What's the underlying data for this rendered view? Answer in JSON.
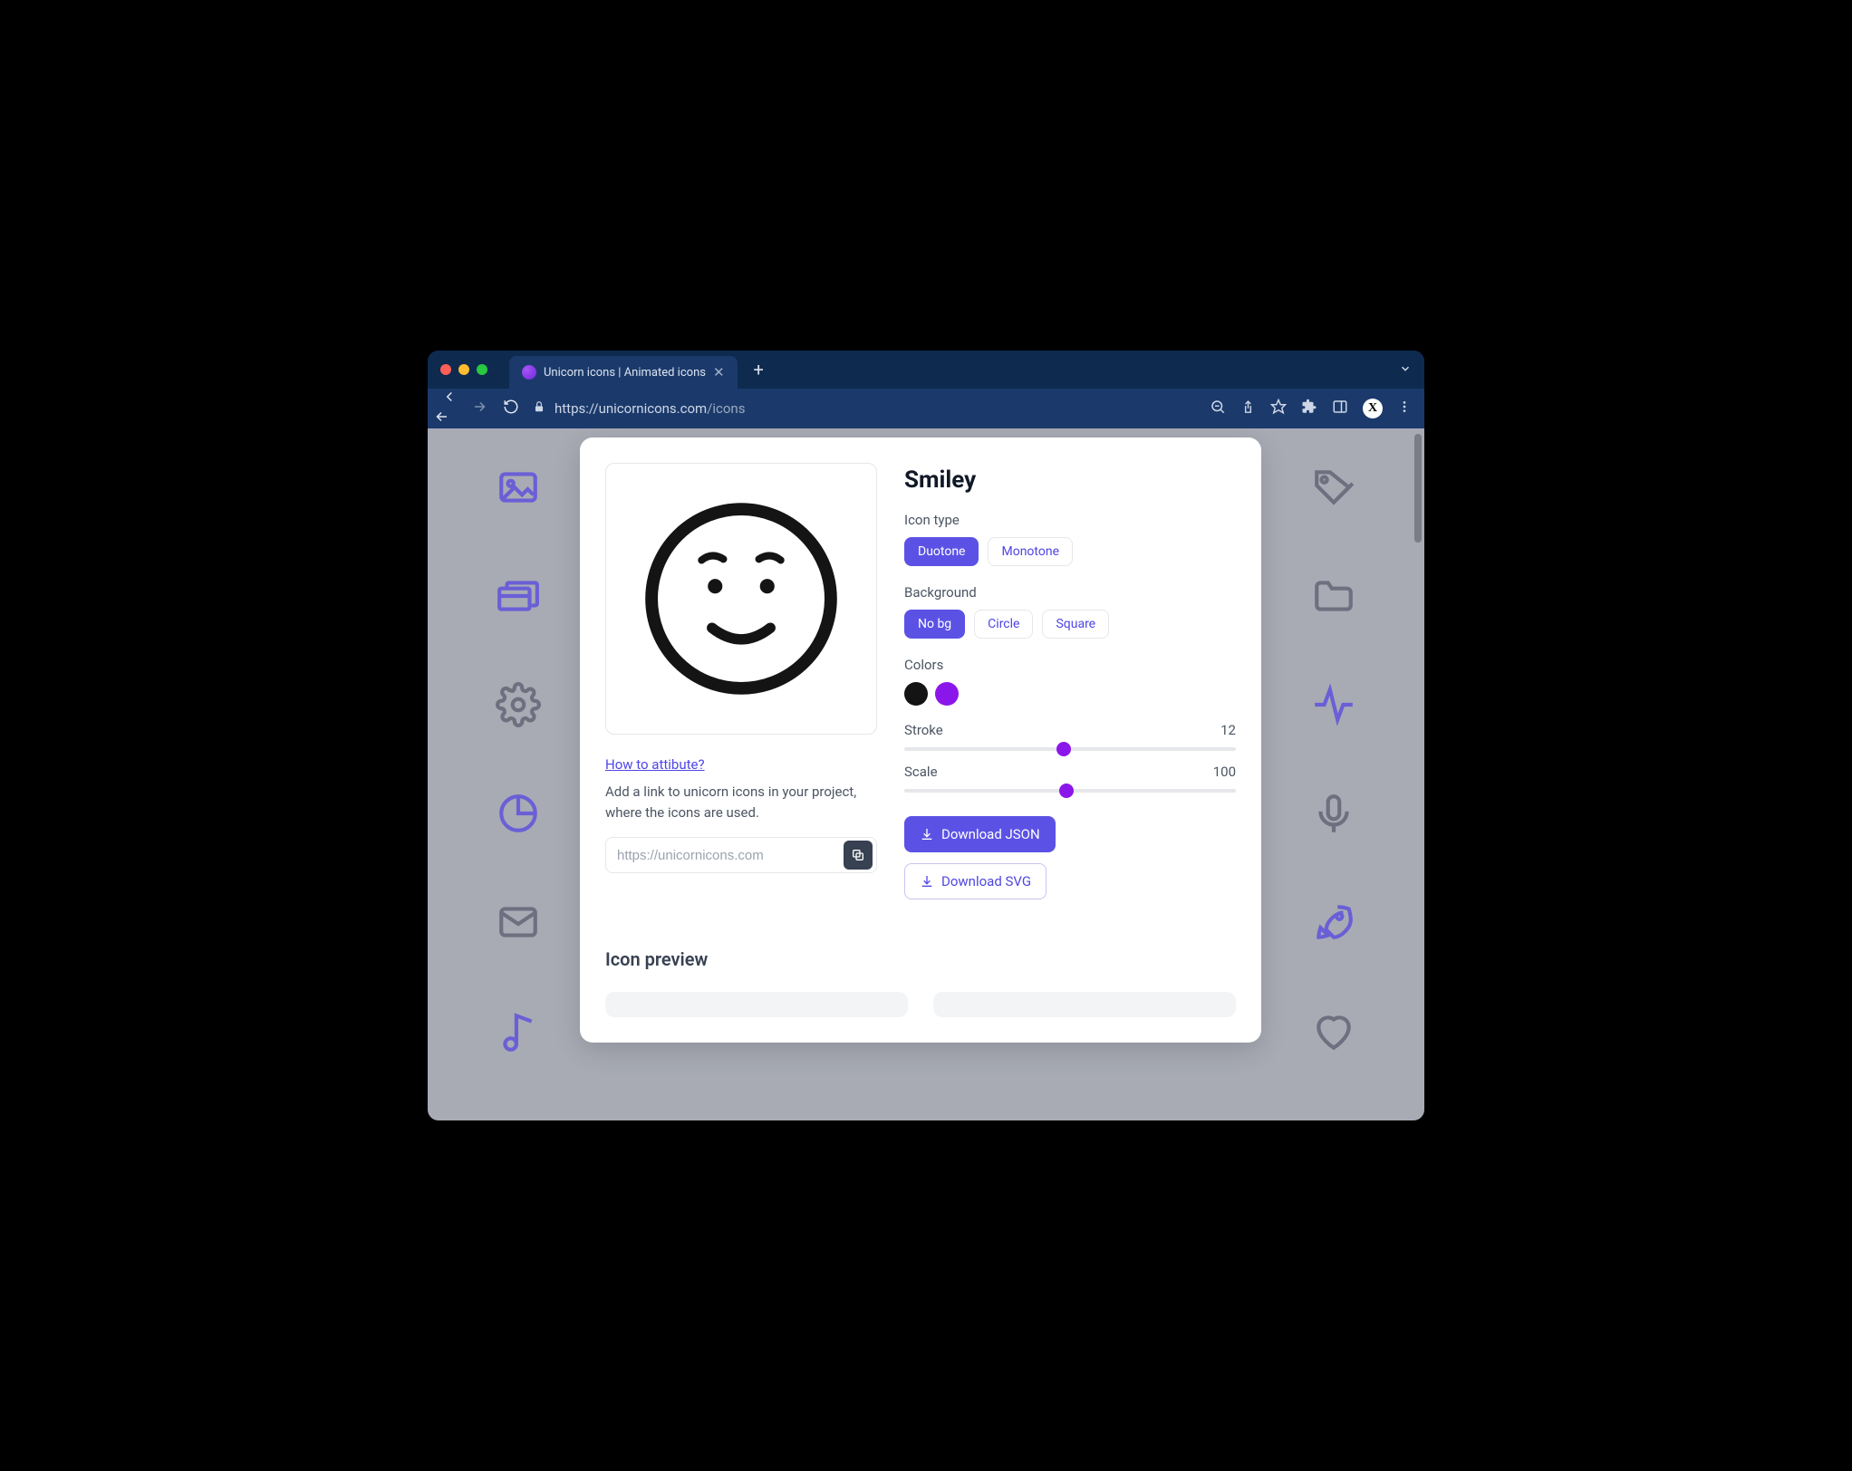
{
  "browser": {
    "tab_title": "Unicorn icons | Animated icons",
    "url_host": "https://unicornicons.com",
    "url_path": "/icons",
    "avatar_letter": "X"
  },
  "bg_icons_left": [
    "image",
    "cards",
    "gear",
    "pie",
    "mail",
    "music"
  ],
  "bg_icons_right": [
    "tag",
    "folder",
    "activity",
    "mic",
    "rocket",
    "heart"
  ],
  "icon": {
    "name": "Smiley",
    "type_label": "Icon type",
    "type_options": {
      "active": "Duotone",
      "other": "Monotone"
    },
    "bg_label": "Background",
    "bg_options": {
      "active": "No bg",
      "circle": "Circle",
      "square": "Square"
    },
    "colors_label": "Colors",
    "swatches": [
      "#141414",
      "#8b16ea"
    ],
    "stroke_label": "Stroke",
    "stroke_value": "12",
    "stroke_thumb_pct": 48,
    "scale_label": "Scale",
    "scale_value": "100",
    "scale_thumb_pct": 49,
    "download_json": "Download JSON",
    "download_svg": "Download SVG"
  },
  "attribution": {
    "link": "How to attibute?",
    "text": "Add a link to unicorn icons in your project, where the icons are used.",
    "url": "https://unicornicons.com"
  },
  "preview_section_title": "Icon preview"
}
